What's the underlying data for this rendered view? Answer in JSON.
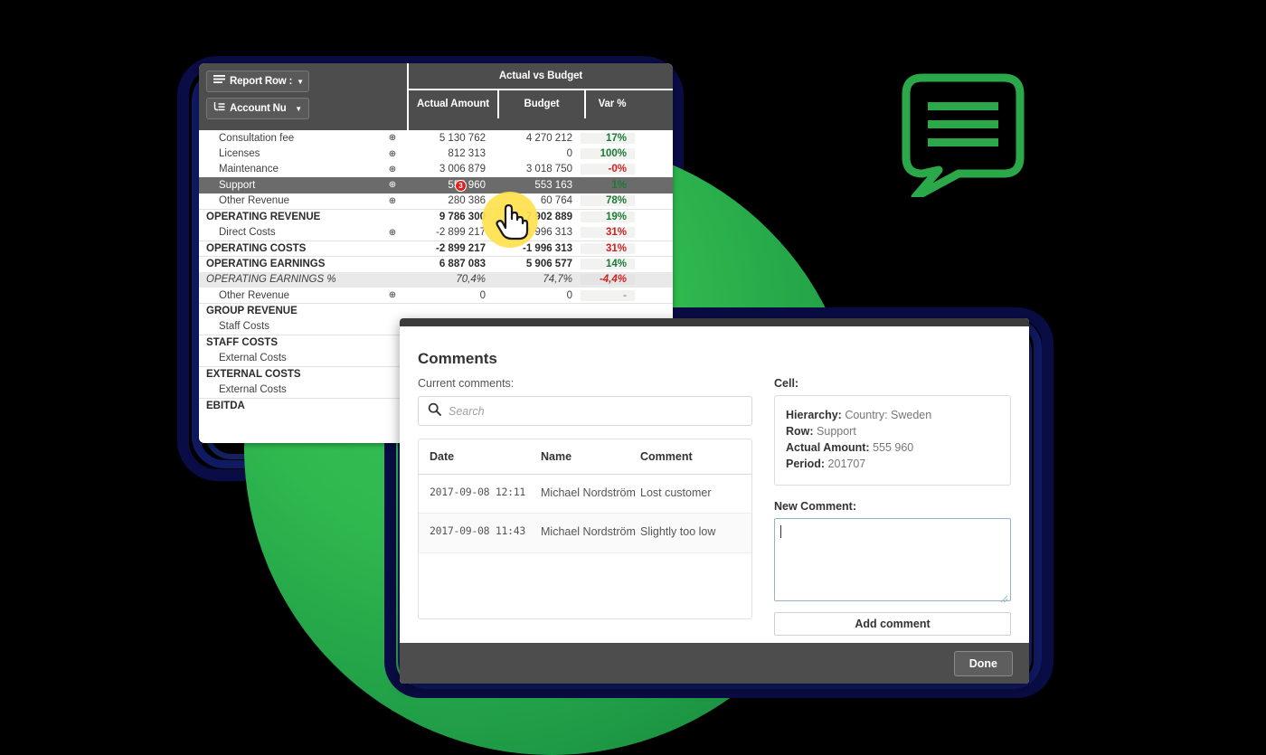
{
  "decor": {
    "bubble_icon": "speech-bubble-icon",
    "bubble_color": "#2aa84a",
    "circle_color": "#2fb84e",
    "ring_color": "#0d1150",
    "background_color": "#000000"
  },
  "pivot": {
    "dimension_buttons": [
      {
        "label": "Report Row :",
        "icon": "list-lines-icon"
      },
      {
        "label": "Account Nu",
        "icon": "drill-down-icon"
      }
    ],
    "caret": "▼",
    "measure_group": "Actual vs Budget",
    "columns": [
      "Actual Amount",
      "Budget",
      "Var %"
    ],
    "expand_icon": "⊕",
    "badge_count": "3",
    "cursor_icon": "pointing-hand-cursor",
    "rows": [
      {
        "label": "Consultation fee",
        "type": "detail",
        "expandable": true,
        "actual": "5 130 762",
        "budget": "4 270 212",
        "var": "17%",
        "var_sign": "pos"
      },
      {
        "label": "Licenses",
        "type": "detail",
        "expandable": true,
        "actual": "812 313",
        "budget": "0",
        "var": "100%",
        "var_sign": "pos"
      },
      {
        "label": "Maintenance",
        "type": "detail",
        "expandable": true,
        "actual": "3 006 879",
        "budget": "3 018 750",
        "var": "-0%",
        "var_sign": "neg"
      },
      {
        "label": "Support",
        "type": "detail",
        "expandable": true,
        "selected": true,
        "badge": "3",
        "actual": "555 960",
        "budget": "553 163",
        "var": "1%",
        "var_sign": "pos"
      },
      {
        "label": "Other Revenue",
        "type": "detail",
        "expandable": true,
        "actual": "280 386",
        "budget": "60 764",
        "var": "78%",
        "var_sign": "pos"
      },
      {
        "label": "OPERATING REVENUE",
        "type": "total",
        "expandable": false,
        "actual": "9 786 300",
        "budget": "7 902 889",
        "var": "19%",
        "var_sign": "pos"
      },
      {
        "label": "Direct Costs",
        "type": "detail",
        "expandable": true,
        "actual": "-2 899 217",
        "budget": "-1 996 313",
        "var": "31%",
        "var_sign": "neg"
      },
      {
        "label": "OPERATING COSTS",
        "type": "total",
        "expandable": false,
        "actual": "-2 899 217",
        "budget": "-1 996 313",
        "var": "31%",
        "var_sign": "neg"
      },
      {
        "label": "OPERATING EARNINGS",
        "type": "total",
        "expandable": false,
        "actual": "6 887 083",
        "budget": "5 906 577",
        "var": "14%",
        "var_sign": "pos"
      },
      {
        "label": "OPERATING EARNINGS %",
        "type": "pct",
        "expandable": false,
        "actual": "70,4%",
        "budget": "74,7%",
        "var": "-4,4%",
        "var_sign": "neg"
      },
      {
        "label": "Other Revenue",
        "type": "detail",
        "expandable": true,
        "actual": "0",
        "budget": "0",
        "var": "-",
        "var_sign": "dash"
      },
      {
        "label": "GROUP REVENUE",
        "type": "total",
        "expandable": false,
        "actual": "",
        "budget": "",
        "var": "",
        "var_sign": "dash"
      },
      {
        "label": "Staff Costs",
        "type": "detail",
        "expandable": false,
        "actual": "",
        "budget": "",
        "var": "",
        "var_sign": "dash"
      },
      {
        "label": "STAFF COSTS",
        "type": "total",
        "expandable": false,
        "actual": "",
        "budget": "",
        "var": "",
        "var_sign": "dash"
      },
      {
        "label": "External Costs",
        "type": "detail",
        "expandable": false,
        "actual": "",
        "budget": "",
        "var": "",
        "var_sign": "dash"
      },
      {
        "label": "EXTERNAL COSTS",
        "type": "total",
        "expandable": false,
        "actual": "",
        "budget": "",
        "var": "",
        "var_sign": "dash"
      },
      {
        "label": "External Costs",
        "type": "detail",
        "expandable": false,
        "actual": "",
        "budget": "",
        "var": "",
        "var_sign": "dash"
      },
      {
        "label": "EBITDA",
        "type": "total",
        "expandable": false,
        "actual": "",
        "budget": "",
        "var": "",
        "var_sign": "dash"
      }
    ]
  },
  "dialog": {
    "title": "Comments",
    "current_comments_label": "Current comments:",
    "search": {
      "placeholder": "Search",
      "value": "",
      "icon": "search-icon"
    },
    "comments_table": {
      "headers": [
        "Date",
        "Name",
        "Comment"
      ],
      "rows": [
        {
          "date": "2017-09-08 12:11",
          "name": "Michael Nordström",
          "comment": "Lost customer"
        },
        {
          "date": "2017-09-08 11:43",
          "name": "Michael Nordström",
          "comment": "Slightly too low"
        }
      ]
    },
    "cell": {
      "label": "Cell:",
      "fields": [
        {
          "key": "Hierarchy:",
          "value": "Country: Sweden"
        },
        {
          "key": "Row:",
          "value": "Support"
        },
        {
          "key": "Actual Amount:",
          "value": "555 960"
        },
        {
          "key": "Period:",
          "value": "201707"
        }
      ]
    },
    "new_comment": {
      "label": "New Comment:",
      "value": "",
      "placeholder": ""
    },
    "add_button": "Add comment",
    "done_button": "Done"
  }
}
